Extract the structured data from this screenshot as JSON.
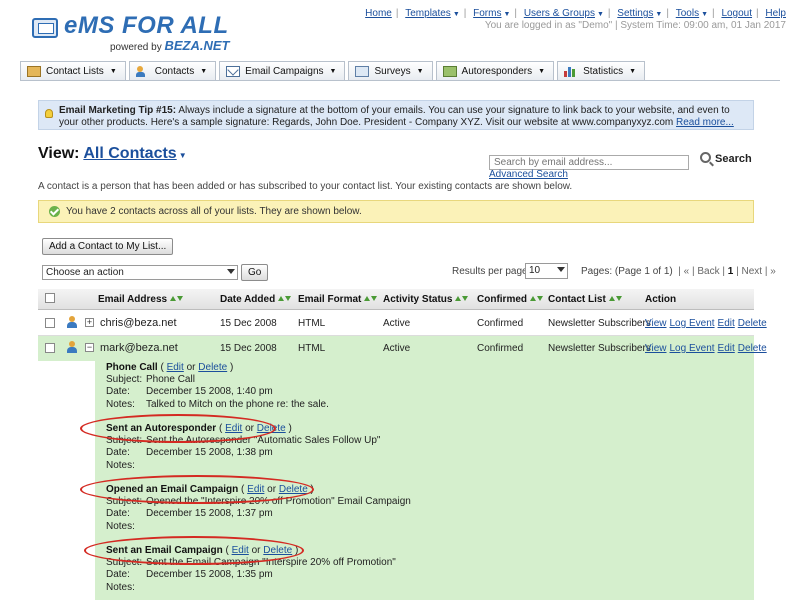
{
  "brand": {
    "name": "eMS FOR ALL",
    "powered_prefix": "powered by",
    "powered_brand": "BEZA.NET"
  },
  "topnav": {
    "items": [
      "Home",
      "Templates",
      "Forms",
      "Users & Groups",
      "Settings",
      "Tools",
      "Logout",
      "Help"
    ],
    "status": "You are logged in as \"Demo\" | System Time: 09:00 am, 01 Jan 2017"
  },
  "tabs": [
    "Contact Lists",
    "Contacts",
    "Email Campaigns",
    "Surveys",
    "Autoresponders",
    "Statistics"
  ],
  "tip": {
    "title": "Email Marketing Tip #15:",
    "text": "Always include a signature at the bottom of your emails. You can use your signature to link back to your website, and even to your other products. Here's a sample signature: Regards, John Doe. President - Company XYZ. Visit our website at www.companyxyz.com",
    "link": "Read more..."
  },
  "view": {
    "label": "View:",
    "selected": "All Contacts",
    "description": "A contact is a person that has been added or has subscribed to your contact list. Your existing contacts are shown below."
  },
  "search": {
    "placeholder": "Search by email address...",
    "button": "Search",
    "advanced": "Advanced Search"
  },
  "info_message": "You have 2 contacts across all of your lists. They are shown below.",
  "add_contact_button": "Add a Contact to My List...",
  "action_select": {
    "value": "Choose an action",
    "go": "Go"
  },
  "results_per_page": {
    "label": "Results per page:",
    "value": "10"
  },
  "pager": {
    "pages": "Pages: (Page 1 of 1)",
    "first": "| «",
    "back": "| Back |",
    "current": "1",
    "next": "| Next |",
    "last": "»"
  },
  "columns": [
    "Email Address",
    "Date Added",
    "Email Format",
    "Activity Status",
    "Confirmed",
    "Contact List",
    "Action"
  ],
  "rows": [
    {
      "email": "chris@beza.net",
      "date": "15 Dec 2008",
      "format": "HTML",
      "status": "Active",
      "confirmed": "Confirmed",
      "list": "Newsletter Subscribers",
      "expander": "+"
    },
    {
      "email": "mark@beza.net",
      "date": "15 Dec 2008",
      "format": "HTML",
      "status": "Active",
      "confirmed": "Confirmed",
      "list": "Newsletter Subscribers",
      "expander": "−"
    }
  ],
  "row_actions": [
    "View",
    "Log Event",
    "Edit",
    "Delete"
  ],
  "event_labels": {
    "subject": "Subject:",
    "date": "Date:",
    "notes": "Notes:",
    "edit": "Edit",
    "delete": "Delete",
    "or": "or"
  },
  "events": [
    {
      "title": "Phone Call",
      "subject": "Phone Call",
      "date": "December 15 2008, 1:40 pm",
      "notes": "Talked to Mitch on the phone re: the sale."
    },
    {
      "title": "Sent an Autoresponder",
      "subject": "Sent the Autoresponder \"Automatic Sales Follow Up\"",
      "date": "December 15 2008, 1:38 pm",
      "notes": ""
    },
    {
      "title": "Opened an Email Campaign",
      "subject": "Opened the \"Interspire 20% off Promotion\" Email Campaign",
      "date": "December 15 2008, 1:37 pm",
      "notes": ""
    },
    {
      "title": "Sent an Email Campaign",
      "subject": "Sent the Email Campaign \"Interspire 20% off Promotion\"",
      "date": "December 15 2008, 1:35 pm",
      "notes": ""
    }
  ],
  "colors": {
    "link": "#1b4f9c",
    "brand": "#2e6db4",
    "highlight_row": "#d5efcd",
    "annotation": "#d42a22"
  }
}
